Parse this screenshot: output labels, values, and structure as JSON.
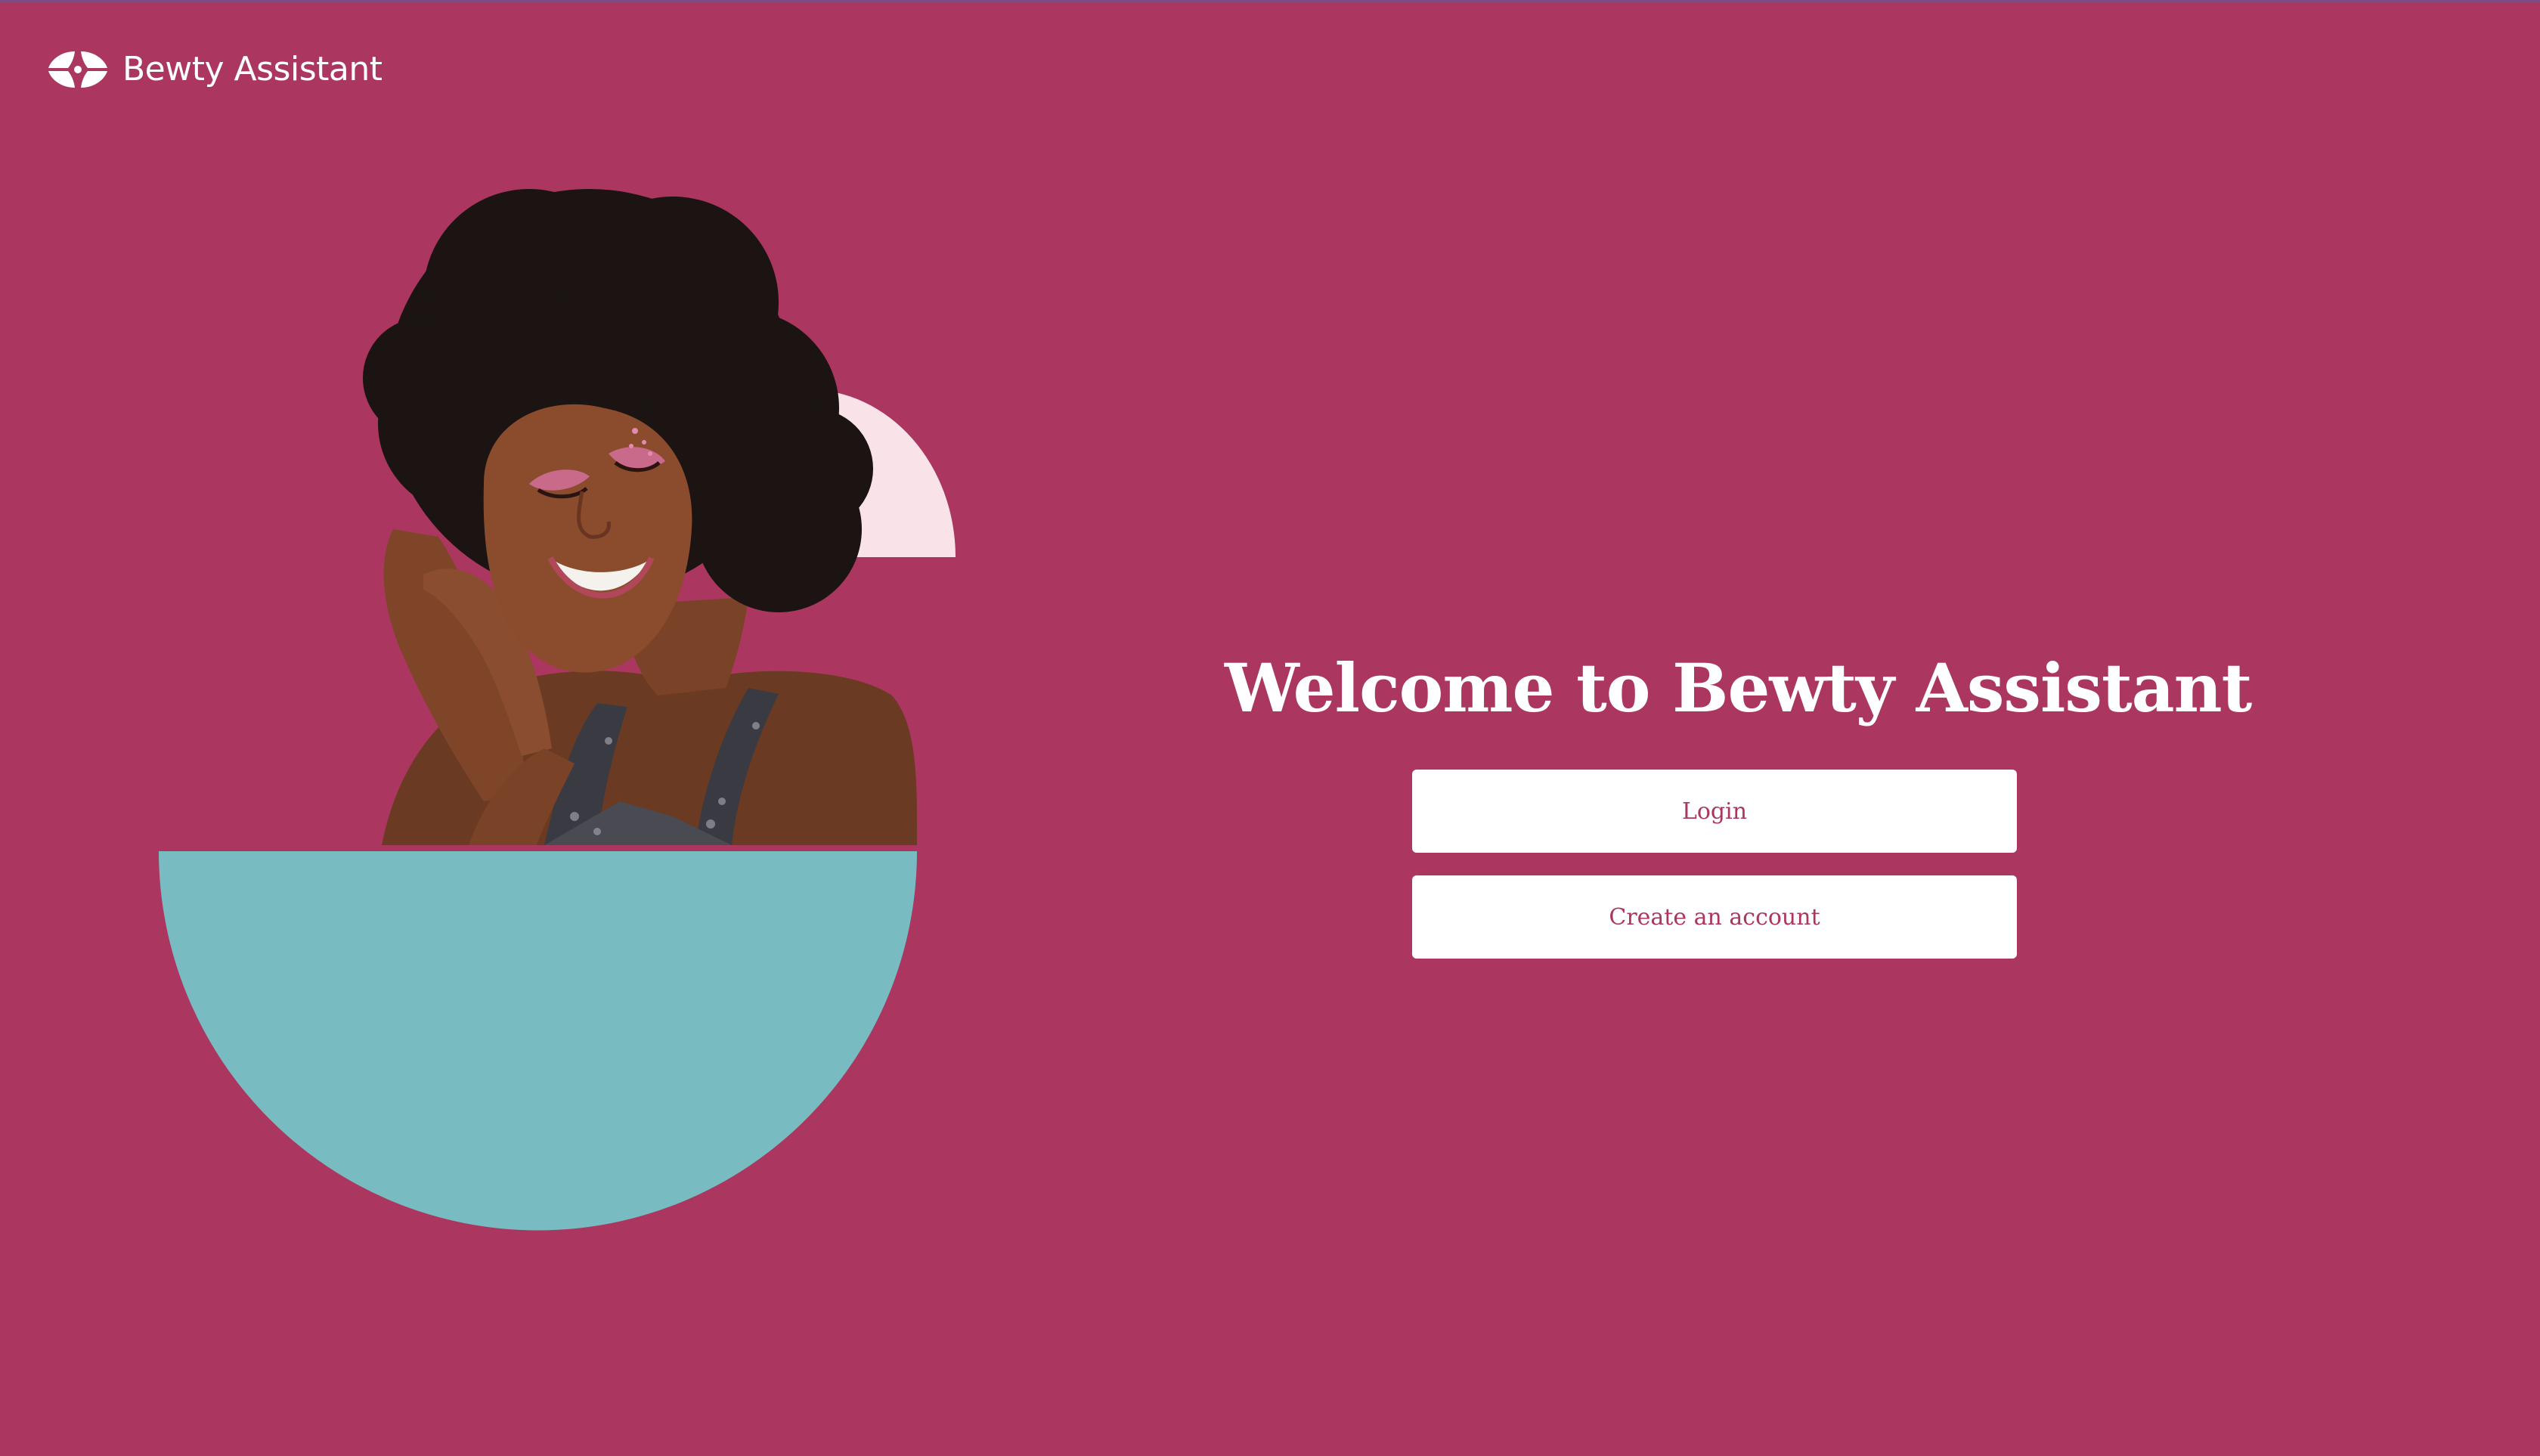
{
  "app": {
    "name": "Bewty Assistant",
    "logo_icon": "bewty-logo-icon"
  },
  "welcome": {
    "title": "Welcome to Bewty Assistant",
    "login_label": "Login",
    "create_account_label": "Create an account"
  },
  "colors": {
    "background": "#AB3761",
    "teal": "#78BBC0",
    "blush": "#FAE3E8",
    "button_bg": "#FFFFFF",
    "button_text": "#AB3761",
    "top_line": "#7E4B83"
  },
  "hero": {
    "image": "woman-portrait-illustration"
  }
}
